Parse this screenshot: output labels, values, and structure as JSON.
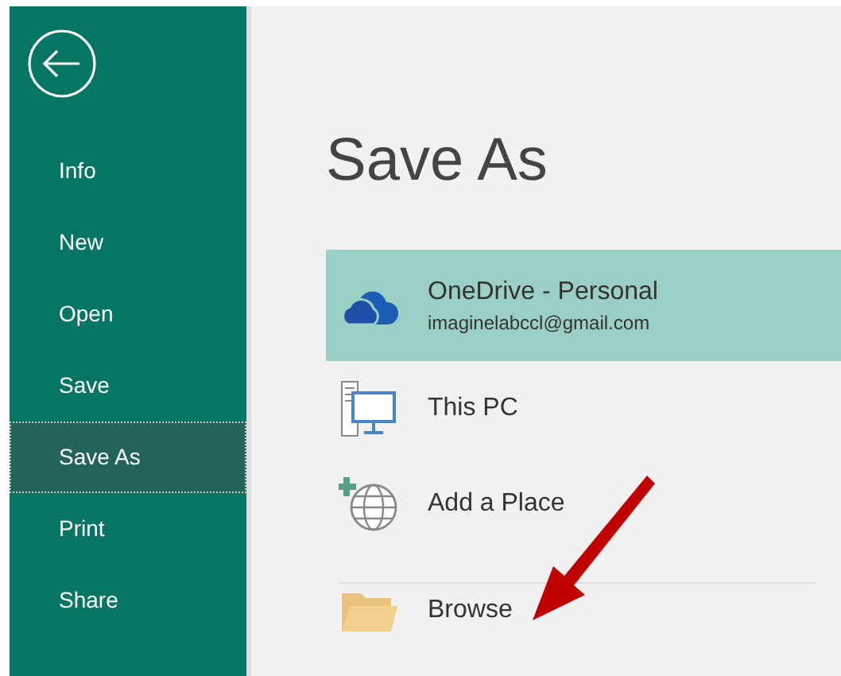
{
  "sidebar": {
    "items": [
      {
        "label": "Info",
        "selected": false
      },
      {
        "label": "New",
        "selected": false
      },
      {
        "label": "Open",
        "selected": false
      },
      {
        "label": "Save",
        "selected": false
      },
      {
        "label": "Save As",
        "selected": true
      },
      {
        "label": "Print",
        "selected": false
      },
      {
        "label": "Share",
        "selected": false
      }
    ]
  },
  "title": "Save As",
  "places": [
    {
      "kind": "cloud",
      "name": "OneDrive - Personal",
      "account": "imaginelabccl@gmail.com",
      "selected": true
    },
    {
      "kind": "pc",
      "name": "This PC",
      "selected": false
    },
    {
      "kind": "add",
      "name": "Add a Place",
      "selected": false
    }
  ],
  "other_places": [
    {
      "kind": "folder",
      "name": "Browse",
      "selected": false
    }
  ]
}
